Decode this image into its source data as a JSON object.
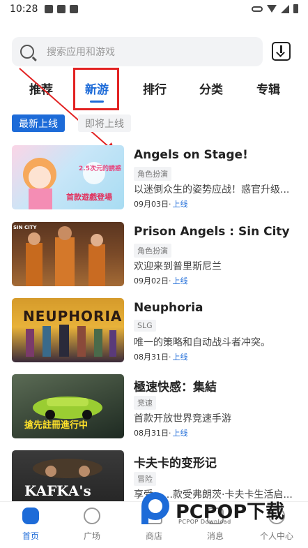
{
  "status_bar": {
    "time": "10:28"
  },
  "search": {
    "placeholder": "搜索应用和游戏"
  },
  "tabs": [
    {
      "label": "推荐"
    },
    {
      "label": "新游"
    },
    {
      "label": "排行"
    },
    {
      "label": "分类"
    },
    {
      "label": "专辑"
    }
  ],
  "active_tab": "新游",
  "filters": [
    {
      "label": "最新上线",
      "active": true
    },
    {
      "label": "即将上线",
      "active": false
    }
  ],
  "games": [
    {
      "title": "Angels on Stage!",
      "tag": "角色扮演",
      "desc": "以迷倒众生的姿势应战！惑官升级...",
      "date": "09月03日·",
      "status": "上线"
    },
    {
      "title": "Prison Angels : Sin City",
      "tag": "角色扮演",
      "desc": "欢迎来到普里斯尼兰",
      "date": "09月02日·",
      "status": "上线"
    },
    {
      "title": "Neuphoria",
      "tag": "SLG",
      "desc": "唯一的策略和自动战斗者冲突。",
      "date": "08月31日·",
      "status": "上线"
    },
    {
      "title": "極速快感：集結",
      "tag": "竞速",
      "desc": "首款开放世界竞速手游",
      "date": "08月31日·",
      "status": "上线"
    },
    {
      "title": "卡夫卡的变形记",
      "tag": "冒险",
      "desc": "享受……款受弗朗茨·卡夫卡生活启...",
      "date": "",
      "status": ""
    }
  ],
  "thumb_texts": {
    "game1_line1": "2.5次元的誘惑",
    "game1_line2": "首款遊戲登場",
    "game2_line1": "SIN CITY",
    "game3_line1": "NEUPHORIA",
    "game4_line1": "搶先註冊進行中",
    "game5_line1": "KAFKA's"
  },
  "bottom_nav": [
    {
      "label": "首页",
      "icon": "gamepad-icon",
      "active": true
    },
    {
      "label": "广场",
      "icon": "planet-icon",
      "active": false
    },
    {
      "label": "商店",
      "icon": "shop-icon",
      "active": false
    },
    {
      "label": "消息",
      "icon": "message-icon",
      "active": false
    },
    {
      "label": "个人中心",
      "icon": "user-icon",
      "active": false
    }
  ],
  "watermark": {
    "text": "PCPOP下载",
    "sub": "PCPOP Download"
  },
  "colors": {
    "accent": "#1d6bd8",
    "annotation": "#e22222"
  }
}
